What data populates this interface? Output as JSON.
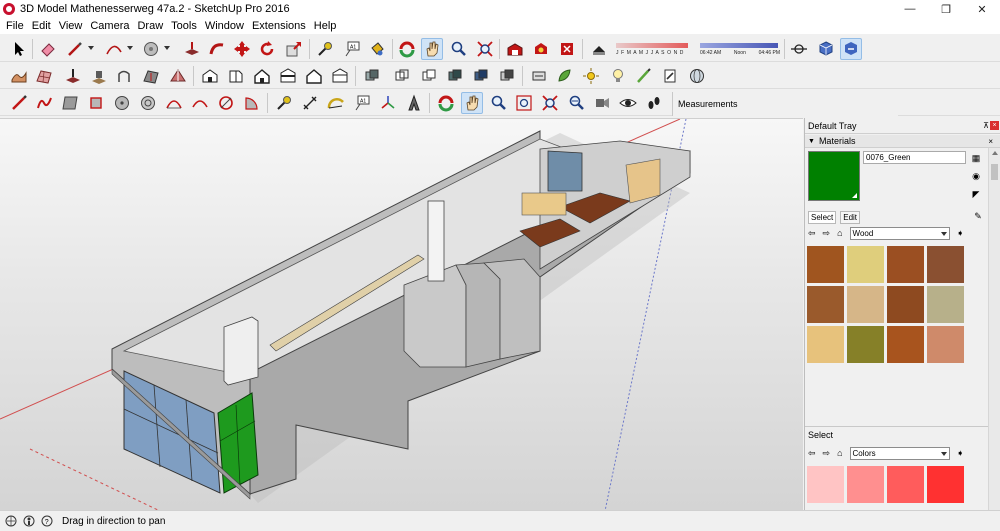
{
  "window": {
    "title": "3D Model Mathenesserweg 47a.2 - SketchUp Pro 2016",
    "minimize_glyph": "—",
    "maximize_glyph": "❐",
    "close_glyph": "✕"
  },
  "menu": [
    "File",
    "Edit",
    "View",
    "Camera",
    "Draw",
    "Tools",
    "Window",
    "Extensions",
    "Help"
  ],
  "shadow": {
    "months": "J F M A M J J A S O N D",
    "time_start": "06:42 AM",
    "time_noon": "Noon",
    "time_end": "04:46 PM"
  },
  "measurements_label": "Measurements",
  "tray": {
    "title": "Default Tray",
    "panel_title": "Materials",
    "material_name": "0076_Green",
    "current_color": "#008000",
    "tabs": [
      "Select",
      "Edit"
    ],
    "library1": "Wood",
    "select_label": "Select",
    "library2": "Colors",
    "wood_swatches": [
      "#a0551f",
      "#dfce7c",
      "#9b4f22",
      "#8a5031",
      "#9a5a2c",
      "#d6b688",
      "#8e4a20",
      "#b7b08a",
      "#e7c27c",
      "#868028",
      "#a8541e",
      "#cf8a6a"
    ],
    "color_swatches": [
      "#ffc4c4",
      "#ff8f8f",
      "#ff5c5c",
      "#ff3131"
    ]
  },
  "status": {
    "text": "Drag in direction to pan"
  },
  "colors": {
    "axis_red": "#d14f4f",
    "axis_green": "#3a8f3a",
    "axis_blue": "#6c78c9",
    "wall": "#c3c3c3"
  }
}
